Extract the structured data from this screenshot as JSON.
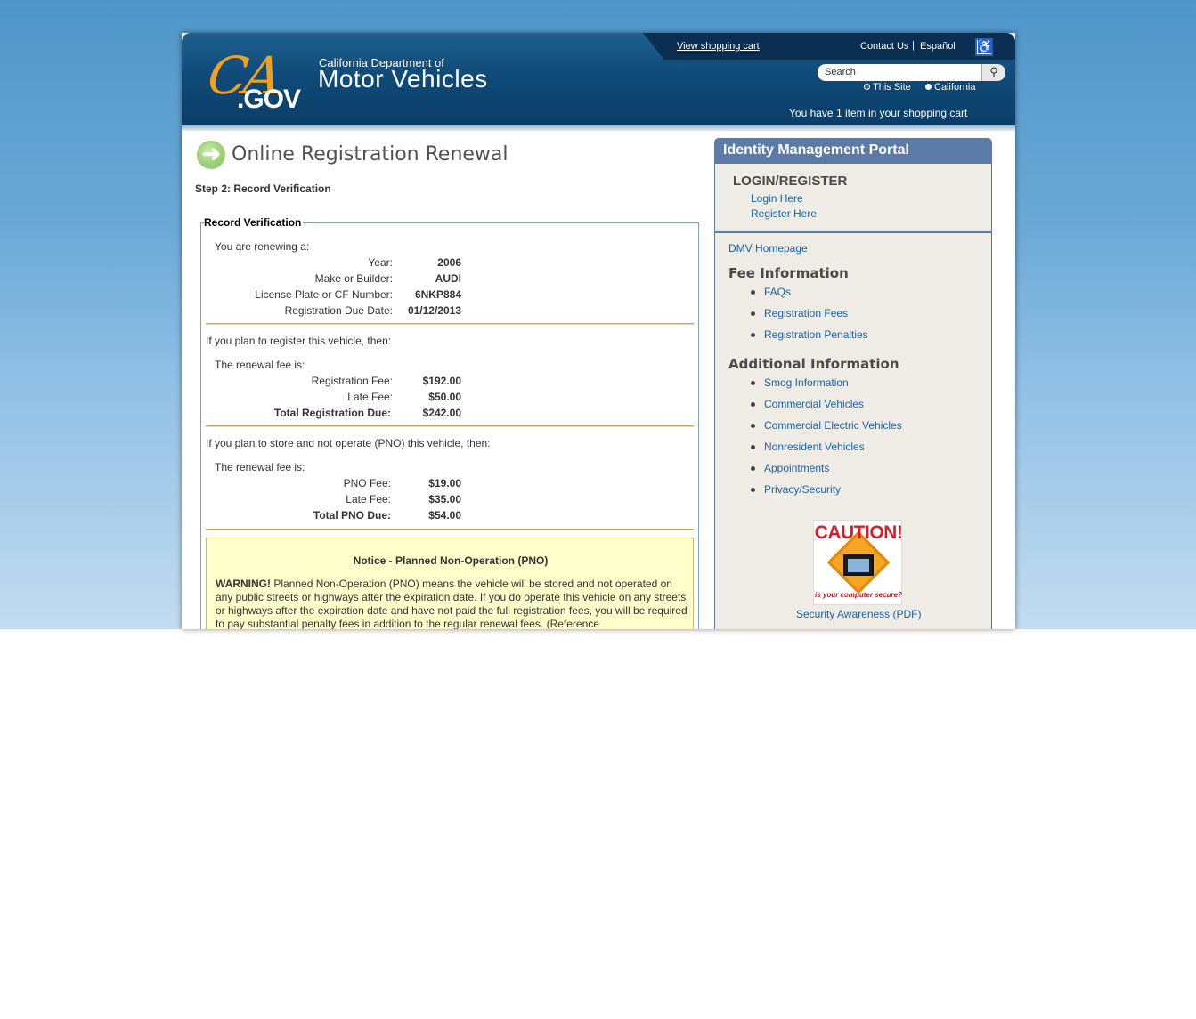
{
  "header": {
    "view_cart": "View shopping cart",
    "contact_us": "Contact Us",
    "separator": "|",
    "espanol": "Español",
    "logo_ca": "CA",
    "logo_gov": ".GOV",
    "dept_line1": "California Department of",
    "dept_line2": "Motor Vehicles",
    "search_placeholder": "Search",
    "radio_this_site": "This Site",
    "radio_california": "California",
    "cart_message": "You have 1 item in your shopping cart"
  },
  "main": {
    "title": "Online Registration Renewal",
    "step": "Step 2: Record Verification",
    "legend": "Record Verification",
    "renewing_intro": "You are renewing a:",
    "vehicle": [
      {
        "label": "Year:",
        "value": "2006"
      },
      {
        "label": "Make or Builder:",
        "value": "AUDI"
      },
      {
        "label": "License Plate or CF Number:",
        "value": "6NKP884"
      },
      {
        "label": "Registration Due Date:",
        "value": "01/12/2013"
      }
    ],
    "register_intro": "If you plan to register this vehicle, then:",
    "renewal_fee_is": "The renewal fee is:",
    "register_fees": [
      {
        "label": "Registration Fee:",
        "value": "$192.00"
      },
      {
        "label": "Late Fee:",
        "value": "$50.00"
      },
      {
        "label": "Total Registration Due:",
        "value": "$242.00"
      }
    ],
    "pno_intro": "If you plan to store and not operate (PNO) this vehicle, then:",
    "pno_fee_is": "The renewal fee is:",
    "pno_fees": [
      {
        "label": "PNO Fee:",
        "value": "$19.00"
      },
      {
        "label": "Late Fee:",
        "value": "$35.00"
      },
      {
        "label": "Total PNO Due:",
        "value": "$54.00"
      }
    ],
    "notice_title": "Notice - Planned Non-Operation (PNO)",
    "notice_warning": "WARNING!",
    "notice_text": " Planned Non-Operation (PNO) means the vehicle will be stored and not operated on any public streets or highways after the expiration date. If you do operate this vehicle on any streets or highways after the expiration date and have not paid the full registration fees, you will be required to pay substantial penalty fees in addition to the regular renewal fees. (Reference"
  },
  "sidebar": {
    "portal_title": "Identity Management Portal",
    "login_heading": "LOGIN/REGISTER",
    "login_here": "Login Here",
    "register_here": "Register Here",
    "dmv_homepage": "DMV Homepage",
    "fee_heading": "Fee Information",
    "fee_links": [
      "FAQs",
      "Registration Fees",
      "Registration Penalties"
    ],
    "additional_heading": "Additional Information",
    "additional_links": [
      "Smog Information",
      "Commercial Vehicles",
      "Commercial Electric Vehicles",
      "Nonresident Vehicles",
      "Appointments",
      "Privacy/Security"
    ],
    "caution_text": "CAUTION!",
    "caution_sub": "is your computer secure?",
    "security_link": "Security Awareness (PDF)"
  },
  "colors": {
    "header_blue": "#0f4a78",
    "portal_blue": "#5b7aa6",
    "link_blue": "#1a62a8",
    "notice_yellow": "#ffffcc",
    "rule_gold": "#c8a84a"
  }
}
